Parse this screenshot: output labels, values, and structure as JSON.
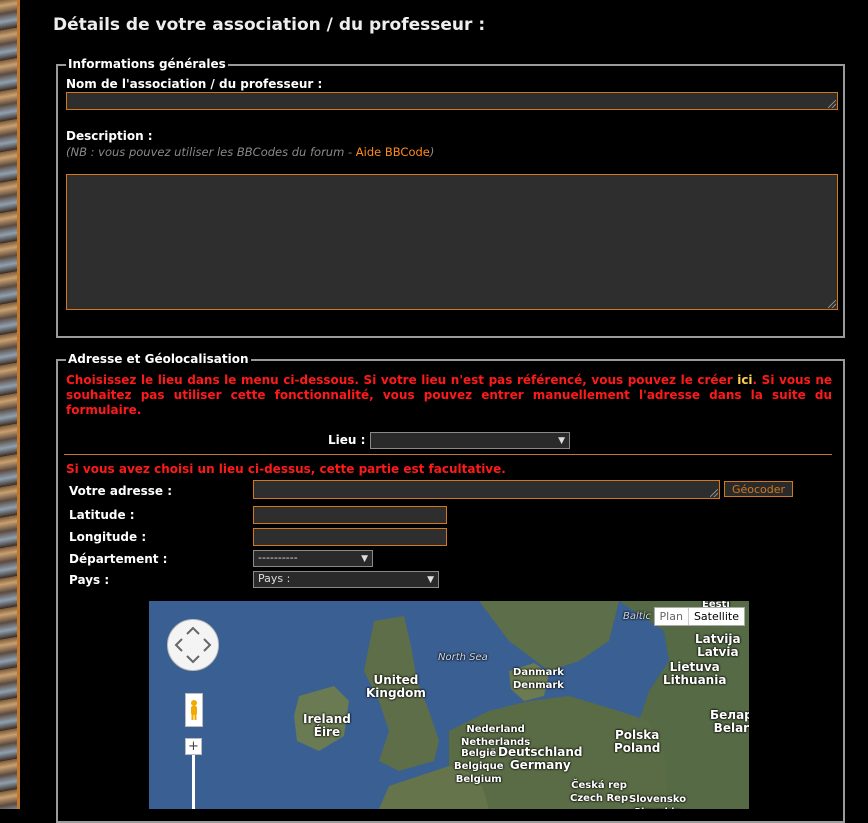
{
  "page": {
    "title": "Détails de votre association / du professeur :"
  },
  "general": {
    "legend": "Informations générales",
    "name_label": "Nom de l'association / du professeur :",
    "description_label": "Description :",
    "note_prefix": "(NB : vous pouvez utiliser les BBCodes du forum - ",
    "note_link": "Aide BBCode",
    "note_suffix": ")"
  },
  "address": {
    "legend": "Adresse et Géolocalisation",
    "instructions_part1": "Choisissez le lieu dans le menu ci-dessous. Si votre lieu n'est pas référencé, vous pouvez le créer ",
    "instructions_link": "ici",
    "instructions_part2": ". Si vous ne souhaitez pas utiliser cette fonctionnalité, vous pouvez entrer manuellement l'adresse dans la suite du formulaire.",
    "lieu_label": "Lieu :",
    "lieu_value": "",
    "optional_note": "Si vous avez choisi un lieu ci-dessus, cette partie est facultative.",
    "address_label": "Votre adresse :",
    "geocode_button": "Géocoder",
    "latitude_label": "Latitude :",
    "longitude_label": "Longitude :",
    "department_label": "Département :",
    "department_value": "----------",
    "country_label": "Pays :",
    "country_value": "Pays :"
  },
  "map": {
    "type_plan": "Plan",
    "type_satellite": "Satellite",
    "zoom_plus": "+",
    "labels": {
      "baltic": "Baltic",
      "eesti": "Eesti",
      "north_sea": "North Sea",
      "uk": "United\nKingdom",
      "ireland": "Ireland\nÉire",
      "denmark": "Danmark\nDenmark",
      "latvia": "Latvija\nLatvia",
      "lithuania": "Lietuva\nLithuania",
      "netherlands": "Nederland\nNetherlands",
      "belgium": "België\nBelgique\nBelgium",
      "germany": "Deutschland\nGermany",
      "poland": "Polska\nPoland",
      "belarus": "Белар\nBelar",
      "czech": "Česká rep\nCzech Rep",
      "slovakia": "Slovensko\nSlovakia"
    }
  },
  "colors": {
    "accent": "#d2781c",
    "warning": "#ff1a1a",
    "field_bg": "#2e2e2e"
  }
}
